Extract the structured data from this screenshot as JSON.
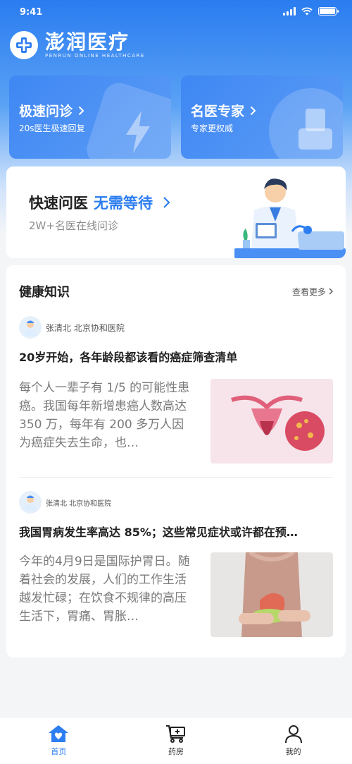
{
  "status_bar": {
    "time": "9:41"
  },
  "brand": {
    "name": "澎润医疗",
    "subtitle": "PENRUN ONLINE HEALTHCARE"
  },
  "top_cards": [
    {
      "title": "极速问诊",
      "subtitle": "20s医生极速回复",
      "icon": "lightning-icon"
    },
    {
      "title": "名医专家",
      "subtitle": "专家更权威",
      "icon": "expert-icon"
    }
  ],
  "quick_consult": {
    "title": "快速问医",
    "accent": "无需等待",
    "subtitle": "2W+名医在线问诊"
  },
  "health": {
    "title": "健康知识",
    "see_more": "查看更多",
    "articles": [
      {
        "author": "张清北 北京协和医院",
        "title": "20岁开始，各年龄段都该看的癌症筛查清单",
        "excerpt": "每个人一辈子有 1/5 的可能性患癌。我国每年新增患癌人数高达 350 万，每年有 200 多万人因为癌症失去生命，也…"
      },
      {
        "author": "张清北 北京协和医院",
        "title": "我国胃病发生率高达 85%；这些常见症状或许都在预…",
        "excerpt": "今年的4月9日是国际护胃日。随着社会的发展，人们的工作生活越发忙碌；在饮食不规律的高压生活下，胃痛、胃胀…"
      }
    ]
  },
  "tabbar": [
    {
      "label": "首页",
      "icon": "home-icon",
      "active": true
    },
    {
      "label": "药房",
      "icon": "pharmacy-cart-icon",
      "active": false
    },
    {
      "label": "我的",
      "icon": "profile-icon",
      "active": false
    }
  ],
  "colors": {
    "accent": "#2d7ef0",
    "card_blue": "#4a8ff4"
  }
}
